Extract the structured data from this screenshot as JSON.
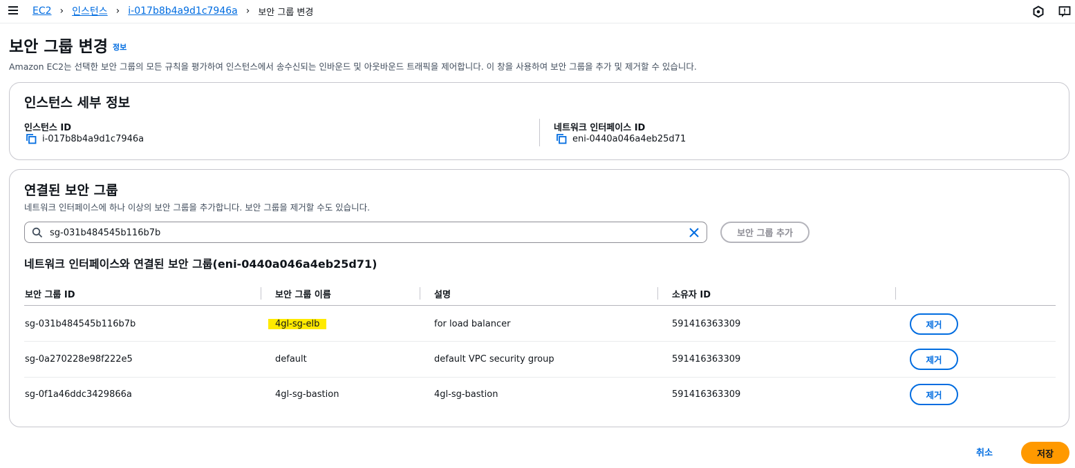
{
  "breadcrumb": {
    "items": [
      "EC2",
      "인스턴스",
      "i-017b8b4a9d1c7946a"
    ],
    "current": "보안 그룹 변경"
  },
  "topbar_icons": [
    "menu-icon",
    "cloudshell-icon",
    "feedback-icon"
  ],
  "page": {
    "title": "보안 그룹 변경",
    "info_link": "정보",
    "description": "Amazon EC2는 선택한 보안 그룹의 모든 규칙을 평가하여 인스턴스에서 송수신되는 인바운드 및 아웃바운드 트래픽을 제어합니다. 이 창을 사용하여 보안 그룹을 추가 및 제거할 수 있습니다."
  },
  "instance_details": {
    "title": "인스턴스 세부 정보",
    "instance_id_label": "인스턴스 ID",
    "instance_id_value": "i-017b8b4a9d1c7946a",
    "eni_label": "네트워크 인터페이스 ID",
    "eni_value": "eni-0440a046a4eb25d71"
  },
  "associated": {
    "title": "연결된 보안 그룹",
    "description": "네트워크 인터페이스에 하나 이상의 보안 그룹을 추가합니다. 보안 그룹을 제거할 수도 있습니다.",
    "search_value": "sg-031b484545b116b7b",
    "add_button": "보안 그룹 추가",
    "table_title": "네트워크 인터페이스와 연결된 보안 그룹(eni-0440a046a4eb25d71)",
    "columns": [
      "보안 그룹 ID",
      "보안 그룹 이름",
      "설명",
      "소유자 ID"
    ],
    "rows": [
      {
        "id": "sg-031b484545b116b7b",
        "name": "4gl-sg-elb",
        "desc": "for load balancer",
        "owner": "591416363309",
        "action": "제거"
      },
      {
        "id": "sg-0a270228e98f222e5",
        "name": "default",
        "desc": "default VPC security group",
        "owner": "591416363309",
        "action": "제거"
      },
      {
        "id": "sg-0f1a46ddc3429866a",
        "name": "4gl-sg-bastion",
        "desc": "4gl-sg-bastion",
        "owner": "591416363309",
        "action": "제거"
      }
    ]
  },
  "footer": {
    "cancel": "취소",
    "save": "저장"
  },
  "colors": {
    "link": "#006ce0",
    "primary_button": "#ff9900",
    "highlight": "#ffea00"
  }
}
